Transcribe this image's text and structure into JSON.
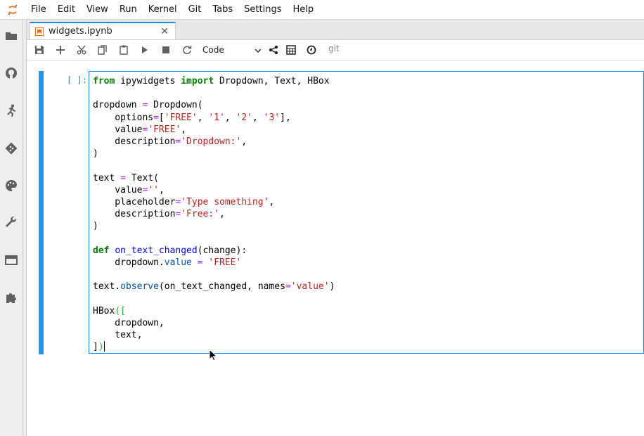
{
  "menubar": {
    "items": [
      "File",
      "Edit",
      "View",
      "Run",
      "Kernel",
      "Git",
      "Tabs",
      "Settings",
      "Help"
    ]
  },
  "sidebar": {
    "icons": [
      "folder-icon",
      "github-icon",
      "running-icon",
      "git-icon",
      "palette-icon",
      "wrench-icon",
      "tab-icon",
      "extension-icon"
    ]
  },
  "tab": {
    "label": "widgets.ipynb",
    "close": "✕"
  },
  "toolbar": {
    "cell_type": "Code",
    "git_label": "git"
  },
  "cell": {
    "prompt": "[ ]:"
  },
  "colors": {
    "accent": "#1e88e5",
    "collapser": "#2196f3",
    "keyword": "#008000",
    "string": "#ba2121",
    "operator": "#aa22ff"
  },
  "code": {
    "lines": [
      [
        {
          "t": "from",
          "c": "kw"
        },
        {
          "t": " ipywidgets "
        },
        {
          "t": "import",
          "c": "kw"
        },
        {
          "t": " Dropdown, Text, HBox"
        }
      ],
      [],
      [
        {
          "t": "dropdown "
        },
        {
          "t": "=",
          "c": "op"
        },
        {
          "t": " Dropdown("
        }
      ],
      [
        {
          "t": "    options"
        },
        {
          "t": "=",
          "c": "op"
        },
        {
          "t": "["
        },
        {
          "t": "'FREE'",
          "c": "str"
        },
        {
          "t": ", "
        },
        {
          "t": "'1'",
          "c": "str"
        },
        {
          "t": ", "
        },
        {
          "t": "'2'",
          "c": "str"
        },
        {
          "t": ", "
        },
        {
          "t": "'3'",
          "c": "str"
        },
        {
          "t": "],"
        }
      ],
      [
        {
          "t": "    value"
        },
        {
          "t": "=",
          "c": "op"
        },
        {
          "t": "'FREE'",
          "c": "str"
        },
        {
          "t": ","
        }
      ],
      [
        {
          "t": "    description"
        },
        {
          "t": "=",
          "c": "op"
        },
        {
          "t": "'Dropdown:'",
          "c": "str"
        },
        {
          "t": ","
        }
      ],
      [
        {
          "t": ")"
        }
      ],
      [],
      [
        {
          "t": "text "
        },
        {
          "t": "=",
          "c": "op"
        },
        {
          "t": " Text("
        }
      ],
      [
        {
          "t": "    value"
        },
        {
          "t": "=",
          "c": "op"
        },
        {
          "t": "''",
          "c": "str"
        },
        {
          "t": ","
        }
      ],
      [
        {
          "t": "    placeholder"
        },
        {
          "t": "=",
          "c": "op"
        },
        {
          "t": "'Type something'",
          "c": "str"
        },
        {
          "t": ","
        }
      ],
      [
        {
          "t": "    description"
        },
        {
          "t": "=",
          "c": "op"
        },
        {
          "t": "'Free:'",
          "c": "str"
        },
        {
          "t": ","
        }
      ],
      [
        {
          "t": ")"
        }
      ],
      [],
      [
        {
          "t": "def",
          "c": "kw"
        },
        {
          "t": " "
        },
        {
          "t": "on_text_changed",
          "c": "fn"
        },
        {
          "t": "(change):"
        }
      ],
      [
        {
          "t": "    dropdown."
        },
        {
          "t": "value",
          "c": "attr"
        },
        {
          "t": " "
        },
        {
          "t": "=",
          "c": "op"
        },
        {
          "t": " "
        },
        {
          "t": "'FREE'",
          "c": "str"
        }
      ],
      [],
      [
        {
          "t": "text."
        },
        {
          "t": "observe",
          "c": "attr"
        },
        {
          "t": "(on_text_changed, names"
        },
        {
          "t": "=",
          "c": "op"
        },
        {
          "t": "'value'",
          "c": "str"
        },
        {
          "t": ")"
        }
      ],
      [],
      [
        {
          "t": "HBox"
        },
        {
          "t": "([",
          "c": "brk-open"
        }
      ],
      [
        {
          "t": "    dropdown,"
        }
      ],
      [
        {
          "t": "    text,"
        }
      ],
      [
        {
          "t": "]"
        },
        {
          "t": ")",
          "c": "brk-open"
        },
        {
          "t": "",
          "c": "caret"
        }
      ]
    ]
  }
}
